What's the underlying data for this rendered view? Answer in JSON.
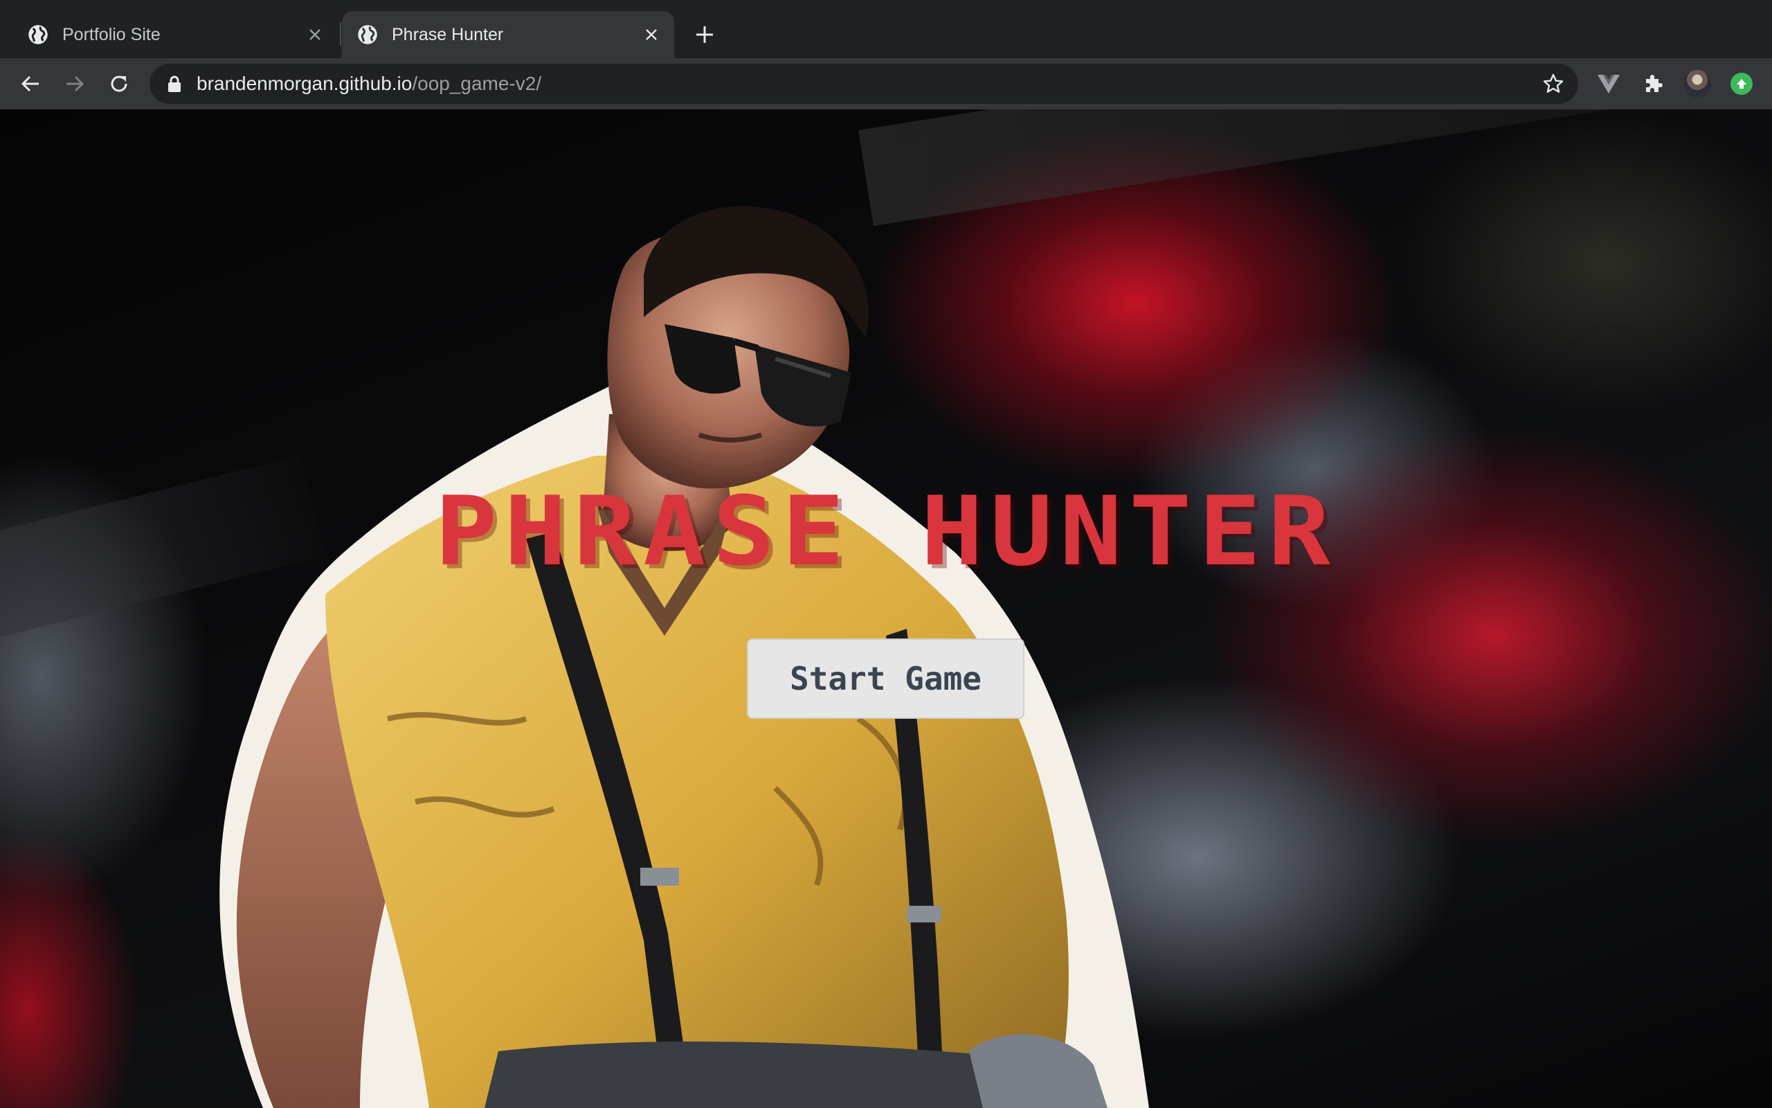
{
  "browser": {
    "tabs": [
      {
        "title": "Portfolio Site",
        "active": false,
        "favicon": "globe-icon"
      },
      {
        "title": "Phrase Hunter",
        "active": true,
        "favicon": "globe-icon"
      }
    ],
    "address_bar": {
      "host": "brandenmorgan.github.io",
      "path": "/oop_game-v2/"
    },
    "toolbar_icons": [
      "back-arrow-icon",
      "forward-arrow-icon",
      "reload-icon",
      "lock-icon",
      "star-icon",
      "vuejs-devtools-icon",
      "puzzle-extensions-icon",
      "profile-avatar-icon",
      "update-icon"
    ]
  },
  "page": {
    "title": "PHRASE HUNTER",
    "start_button_label": "Start Game"
  },
  "colors": {
    "title_red": "#d9353d",
    "button_bg": "#e6e6e6",
    "button_text": "#3b4550",
    "chrome_dark": "#202124",
    "chrome_toolbar": "#35363a"
  }
}
